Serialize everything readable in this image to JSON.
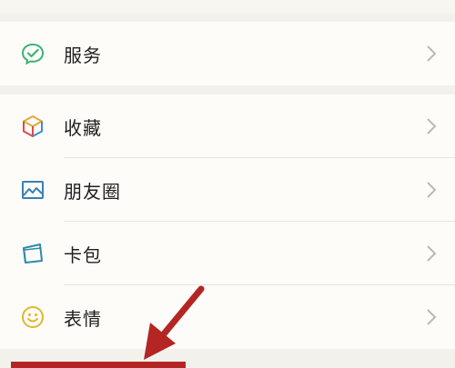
{
  "menu": {
    "group1": [
      {
        "label": "服务",
        "icon": "wechat-pay-icon"
      }
    ],
    "group2": [
      {
        "label": "收藏",
        "icon": "favorites-cube-icon"
      },
      {
        "label": "朋友圈",
        "icon": "moments-picture-icon"
      },
      {
        "label": "卡包",
        "icon": "card-wallet-icon"
      },
      {
        "label": "表情",
        "icon": "emoji-smiley-icon"
      }
    ]
  },
  "colors": {
    "background": "#f3f1ec",
    "row_background": "#fdfcf9",
    "annotation_red": "#b32624",
    "chevron": "#b9b9b9",
    "wechat_green": "#3cb371"
  }
}
